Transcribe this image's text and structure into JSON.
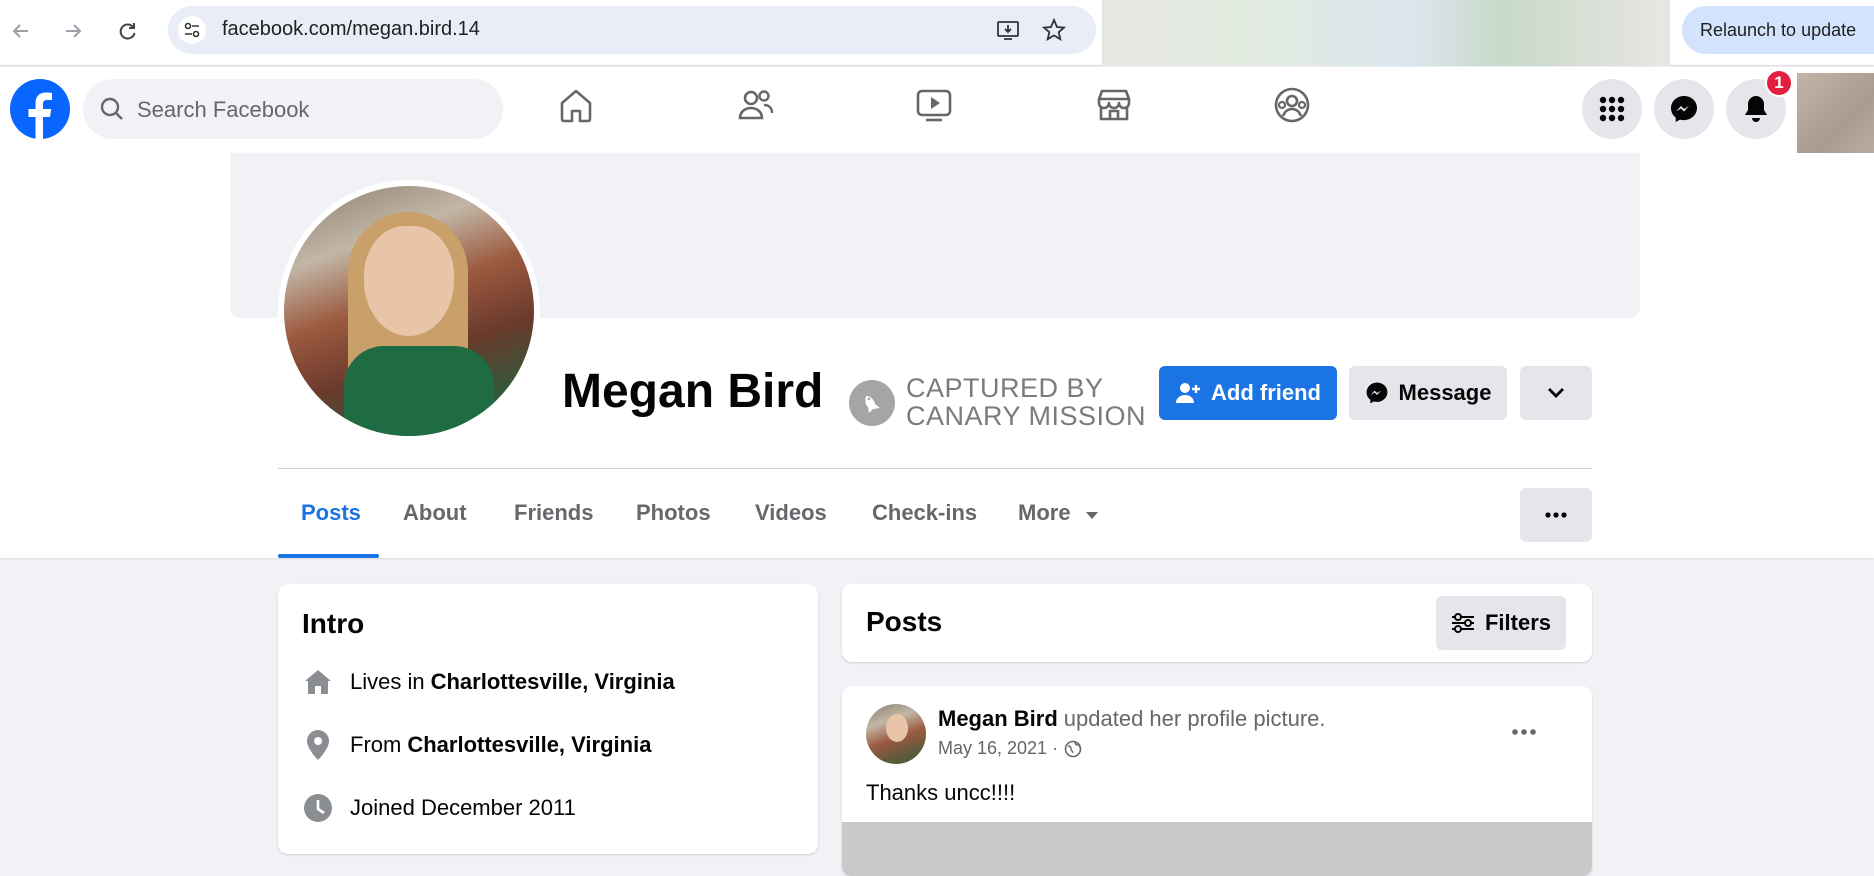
{
  "browser": {
    "url": "facebook.com/megan.bird.14",
    "relaunch_label": "Relaunch to update"
  },
  "topbar": {
    "search_placeholder": "Search Facebook",
    "notification_count": "1"
  },
  "profile": {
    "name": "Megan Bird",
    "watermark_line1": "CAPTURED BY",
    "watermark_line2": "CANARY MISSION",
    "add_friend_label": "Add friend",
    "message_label": "Message"
  },
  "tabs": [
    {
      "label": "Posts",
      "active": true
    },
    {
      "label": "About"
    },
    {
      "label": "Friends"
    },
    {
      "label": "Photos"
    },
    {
      "label": "Videos"
    },
    {
      "label": "Check-ins"
    },
    {
      "label": "More"
    }
  ],
  "intro": {
    "title": "Intro",
    "rows": [
      {
        "icon": "home-icon",
        "prefix": "Lives in",
        "value": "Charlottesville, Virginia"
      },
      {
        "icon": "location-pin-icon",
        "prefix": "From",
        "value": "Charlottesville, Virginia"
      },
      {
        "icon": "clock-icon",
        "prefix": "Joined December 2011",
        "value": ""
      }
    ]
  },
  "posts": {
    "title": "Posts",
    "filters_label": "Filters",
    "items": [
      {
        "author": "Megan Bird",
        "action": "updated her profile picture.",
        "date": "May 16, 2021 ·",
        "text": "Thanks uncc!!!!"
      }
    ]
  },
  "colors": {
    "brand": "#1b74e4",
    "badge": "#e41e3f"
  }
}
